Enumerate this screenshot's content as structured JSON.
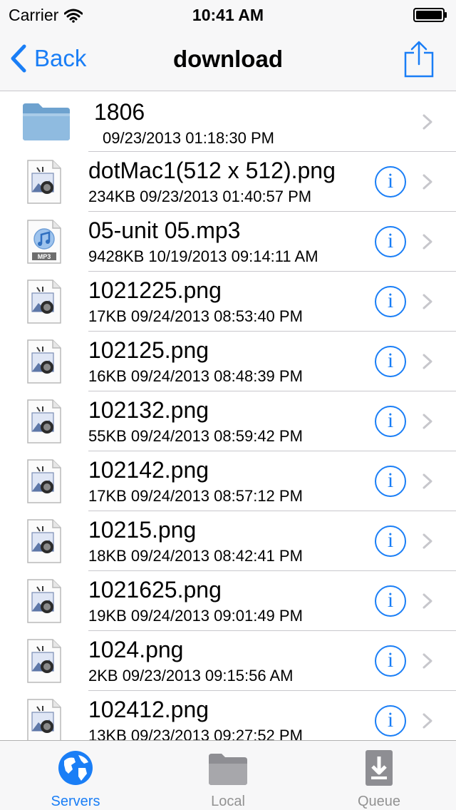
{
  "status_bar": {
    "carrier": "Carrier",
    "time": "10:41 AM"
  },
  "nav": {
    "back_label": "Back",
    "title": "download"
  },
  "files": [
    {
      "name": "1806",
      "meta": "09/23/2013 01:18:30 PM",
      "type": "folder"
    },
    {
      "name": "dotMac1(512 x 512).png",
      "meta": "234KB  09/23/2013 01:40:57 PM",
      "type": "png"
    },
    {
      "name": "05-unit 05.mp3",
      "meta": "9428KB  10/19/2013 09:14:11 AM",
      "type": "mp3"
    },
    {
      "name": "1021225.png",
      "meta": "17KB  09/24/2013 08:53:40 PM",
      "type": "png"
    },
    {
      "name": "102125.png",
      "meta": "16KB  09/24/2013 08:48:39 PM",
      "type": "png"
    },
    {
      "name": "102132.png",
      "meta": "55KB  09/24/2013 08:59:42 PM",
      "type": "png"
    },
    {
      "name": "102142.png",
      "meta": "17KB  09/24/2013 08:57:12 PM",
      "type": "png"
    },
    {
      "name": "10215.png",
      "meta": "18KB  09/24/2013 08:42:41 PM",
      "type": "png"
    },
    {
      "name": "1021625.png",
      "meta": "19KB  09/24/2013 09:01:49 PM",
      "type": "png"
    },
    {
      "name": "1024.png",
      "meta": "2KB  09/23/2013 09:15:56 AM",
      "type": "png"
    },
    {
      "name": "102412.png",
      "meta": "13KB  09/23/2013 09:27:52 PM",
      "type": "png"
    }
  ],
  "mp3_badge": "MP3",
  "info_glyph": "i",
  "tabs": [
    {
      "label": "Servers",
      "icon": "globe-icon",
      "active": true
    },
    {
      "label": "Local",
      "icon": "folder-icon",
      "active": false
    },
    {
      "label": "Queue",
      "icon": "download-icon",
      "active": false
    }
  ],
  "colors": {
    "accent": "#1a7ef6",
    "separator": "#c8c7cc",
    "chevron": "#c7c7cc",
    "inactive_tab": "#929292"
  }
}
